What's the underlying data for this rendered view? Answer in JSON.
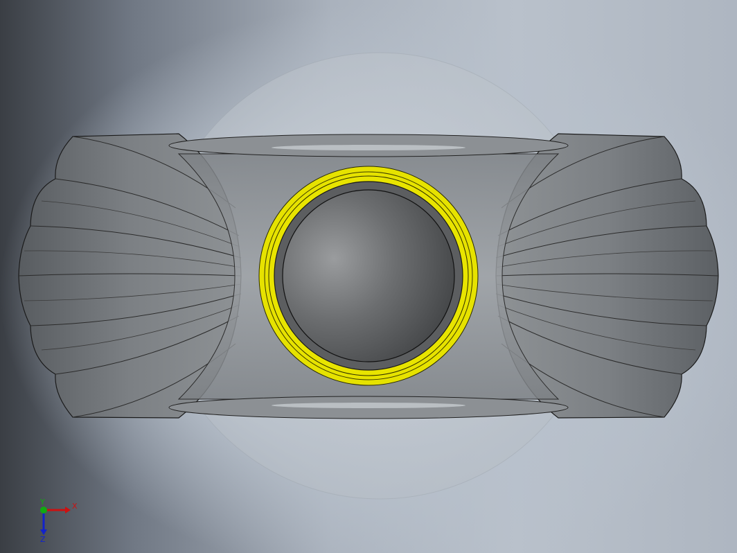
{
  "viewport": {
    "background_gradient": [
      "#3a3e44",
      "#b9c1cb"
    ]
  },
  "model": {
    "body_color": "#8a8d90",
    "gear_color": "#6e7275",
    "highlight_ring_color": "#e6e200",
    "transparent_sphere_color": "#c9ced4"
  },
  "triad": {
    "x_label": "X",
    "y_label": "Y",
    "z_label": "Z",
    "x_color": "#cc1111",
    "y_color": "#11aa11",
    "z_color": "#1122cc"
  }
}
